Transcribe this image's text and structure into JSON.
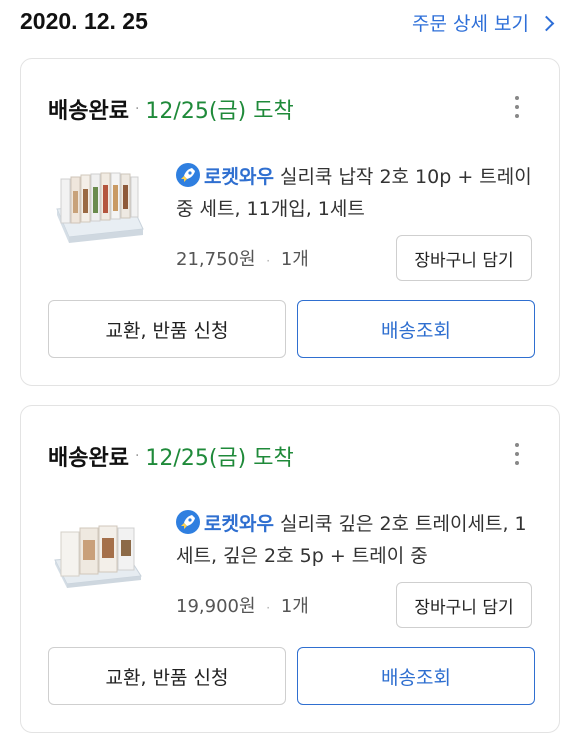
{
  "header": {
    "date": "2020. 12. 25",
    "detail_link": "주문 상세 보기"
  },
  "orders": [
    {
      "status": "배송완료",
      "arrival": "12/25(금) 도착",
      "brand": "로켓와우",
      "title": "실리쿡 납작 2호 10p + 트레이 중 세트, 11개입, 1세트",
      "price": "21,750원",
      "qty": "1개",
      "cart_label": "장바구니 담기",
      "exchange_label": "교환, 반품 신청",
      "track_label": "배송조회"
    },
    {
      "status": "배송완료",
      "arrival": "12/25(금) 도착",
      "brand": "로켓와우",
      "title": "실리쿡 깊은 2호 트레이세트, 1세트, 깊은 2호 5p + 트레이 중",
      "price": "19,900원",
      "qty": "1개",
      "cart_label": "장바구니 담기",
      "exchange_label": "교환, 반품 신청",
      "track_label": "배송조회"
    }
  ],
  "icons": {
    "more": "more-vertical-icon",
    "rocket": "rocket-icon",
    "chevron": "chevron-right-icon"
  },
  "colors": {
    "accent": "#2f6fd0",
    "arrival": "#1f8a3a"
  }
}
